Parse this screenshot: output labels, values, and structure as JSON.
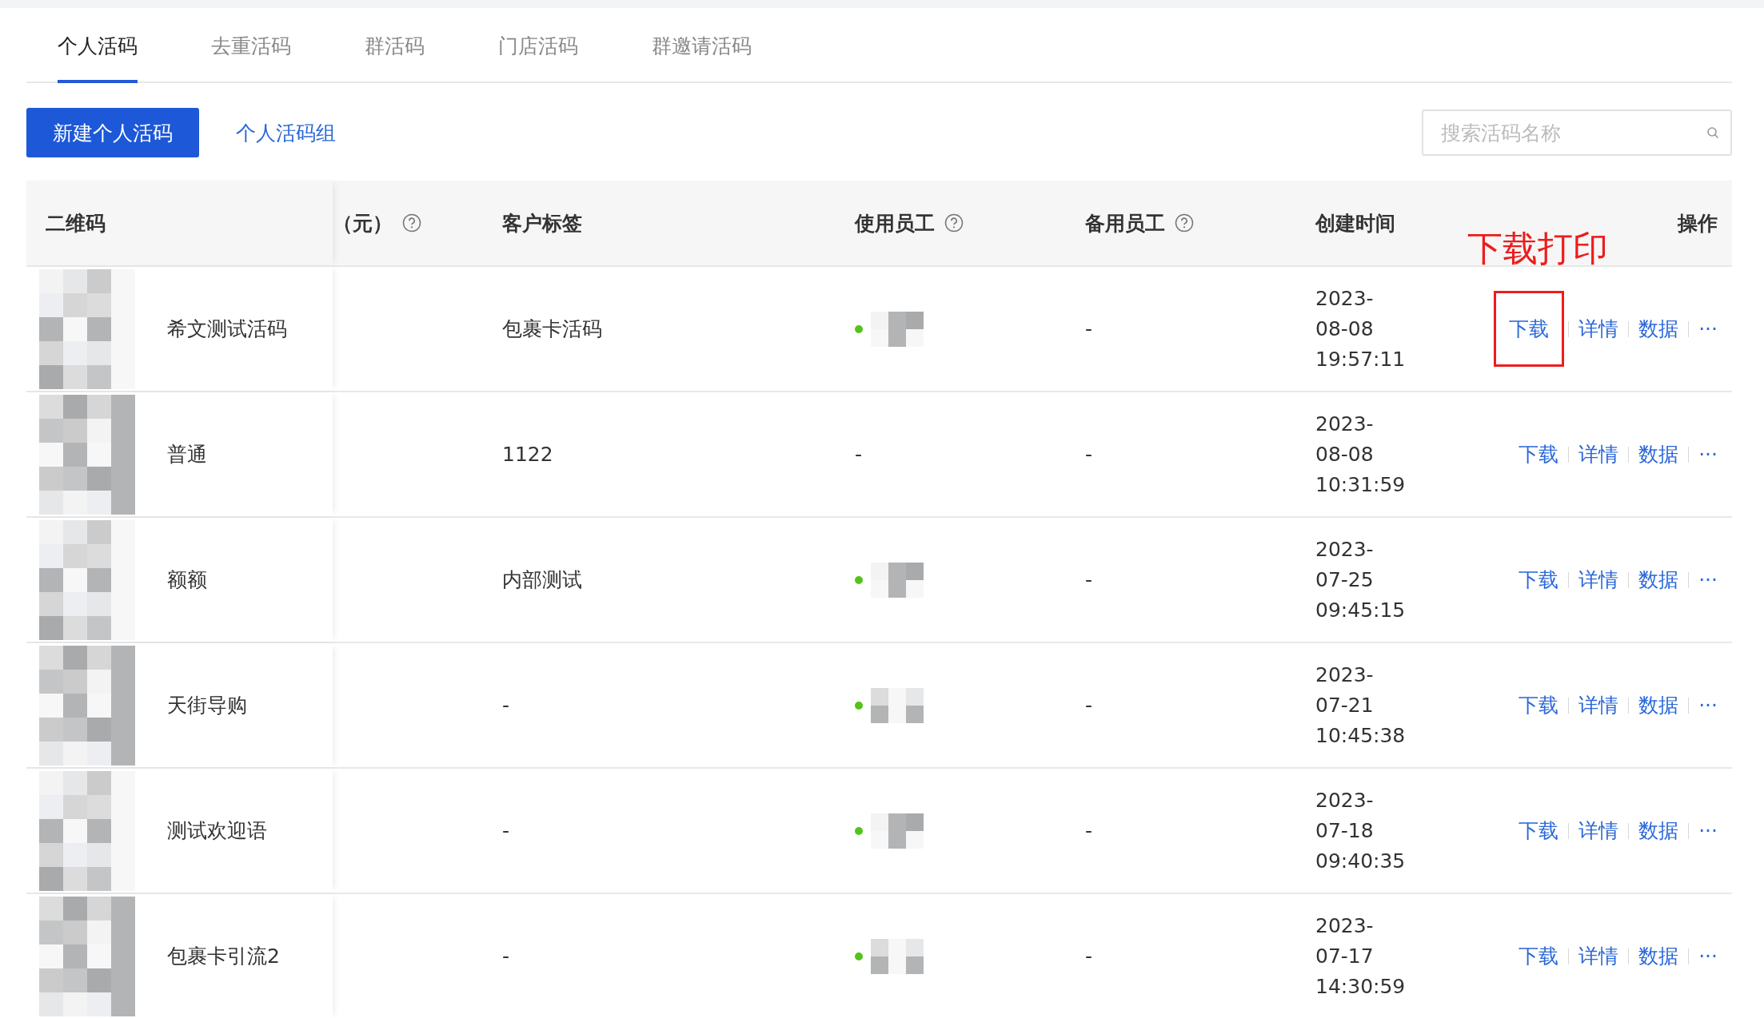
{
  "tabs": [
    {
      "label": "个人活码",
      "selected": true
    },
    {
      "label": "去重活码",
      "selected": false
    },
    {
      "label": "群活码",
      "selected": false
    },
    {
      "label": "门店活码",
      "selected": false
    },
    {
      "label": "群邀请活码",
      "selected": false
    }
  ],
  "toolbar": {
    "create_button": "新建个人活码",
    "group_link": "个人活码组",
    "search": {
      "placeholder": "搜索活码名称"
    }
  },
  "table": {
    "columns": [
      {
        "label": "二维码",
        "help": false
      },
      {
        "label": "（元）",
        "help": true
      },
      {
        "label": "客户标签",
        "help": false
      },
      {
        "label": "使用员工",
        "help": true
      },
      {
        "label": "备用员工",
        "help": true
      },
      {
        "label": "创建时间",
        "help": false
      },
      {
        "label": "操作",
        "help": false
      }
    ],
    "rows": [
      {
        "name": "希文测试活码",
        "tag": "包裹卡活码",
        "staff": {
          "kind": "avatar",
          "color": "#52c41a"
        },
        "backup": "-",
        "created": [
          "2023-",
          "08-08",
          "19:57:11"
        ],
        "actions": [
          {
            "label": "下载",
            "boxed": true
          },
          {
            "label": "详情",
            "boxed": false
          },
          {
            "label": "数据",
            "boxed": false
          },
          {
            "label": "···",
            "boxed": false
          }
        ]
      },
      {
        "name": "普通",
        "tag": "1122",
        "staff": {
          "kind": "text",
          "text": "-"
        },
        "backup": "-",
        "created": [
          "2023-",
          "08-08",
          "10:31:59"
        ],
        "actions": [
          {
            "label": "下载",
            "boxed": false
          },
          {
            "label": "详情",
            "boxed": false
          },
          {
            "label": "数据",
            "boxed": false
          },
          {
            "label": "···",
            "boxed": false
          }
        ]
      },
      {
        "name": "额额",
        "tag": "内部测试",
        "staff": {
          "kind": "avatar",
          "color": "#52c41a"
        },
        "backup": "-",
        "created": [
          "2023-",
          "07-25",
          "09:45:15"
        ],
        "actions": [
          {
            "label": "下载",
            "boxed": false
          },
          {
            "label": "详情",
            "boxed": false
          },
          {
            "label": "数据",
            "boxed": false
          },
          {
            "label": "···",
            "boxed": false
          }
        ]
      },
      {
        "name": "天街导购",
        "tag": "-",
        "staff": {
          "kind": "avatar",
          "color": "#52c41a"
        },
        "backup": "-",
        "created": [
          "2023-",
          "07-21",
          "10:45:38"
        ],
        "actions": [
          {
            "label": "下载",
            "boxed": false
          },
          {
            "label": "详情",
            "boxed": false
          },
          {
            "label": "数据",
            "boxed": false
          },
          {
            "label": "···",
            "boxed": false
          }
        ]
      },
      {
        "name": "测试欢迎语",
        "tag": "-",
        "staff": {
          "kind": "avatar",
          "color": "#52c41a"
        },
        "backup": "-",
        "created": [
          "2023-",
          "07-18",
          "09:40:35"
        ],
        "actions": [
          {
            "label": "下载",
            "boxed": false
          },
          {
            "label": "详情",
            "boxed": false
          },
          {
            "label": "数据",
            "boxed": false
          },
          {
            "label": "···",
            "boxed": false
          }
        ]
      },
      {
        "name": "包裹卡引流2",
        "tag": "-",
        "staff": {
          "kind": "avatar",
          "color": "#52c41a"
        },
        "backup": "-",
        "created": [
          "2023-",
          "07-17",
          "14:30:59"
        ],
        "actions": [
          {
            "label": "下载",
            "boxed": false
          },
          {
            "label": "详情",
            "boxed": false
          },
          {
            "label": "数据",
            "boxed": false
          },
          {
            "label": "···",
            "boxed": false
          }
        ]
      }
    ]
  },
  "annotation": {
    "label": "下载打印"
  }
}
